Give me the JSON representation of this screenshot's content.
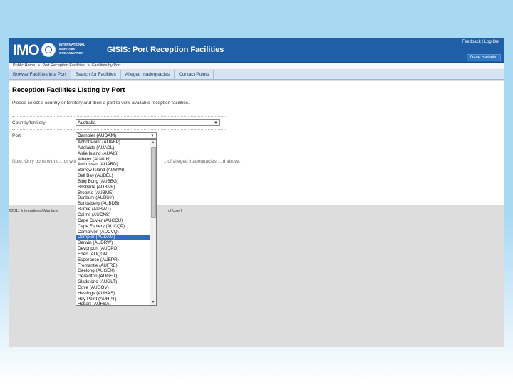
{
  "header": {
    "logo_text": "IMO",
    "org_lines": [
      "INTERNATIONAL",
      "MARITIME",
      "ORGANIZATION"
    ],
    "app_title": "GISIS: Port Reception Facilities",
    "feedback_link": "Feedback",
    "separator": "|",
    "logout_link": "Log Out",
    "user_button": "Dave Harbello"
  },
  "breadcrumb": [
    "Public Home",
    ">",
    "Port Reception Facilities",
    ">",
    "Facilities by Port"
  ],
  "tabs": [
    "Browse Facilities in a Port",
    "Search for Facilities",
    "Alleged Inadequacies",
    "Contact Points"
  ],
  "main": {
    "title": "Reception Facilities Listing by Port",
    "intro": "Please select a country or territory and then a port to view available reception facilities.",
    "country_label": "Country/territory:",
    "country_value": "Australia",
    "port_label": "Port:",
    "port_value": "Dampier (AUDAM)",
    "note_left": "Note: Only ports with c... or with specific informa...",
    "note_right": "...of alleged inadequacies, ...d above."
  },
  "footer": {
    "copyright": "©2011 International Maritime",
    "terms": "of Use ]"
  },
  "port_options": [
    "Abbot Point (AUABP)",
    "Adelaide (AUADL)",
    "Airlie Island (AUAIS)",
    "Albany (AUALH)",
    "Ardrossan (AUARD)",
    "Barrow Island (AUBWB)",
    "Bell Bay (AUBEL)",
    "Bing Bong (AUBBG)",
    "Brisbane (AUBNE)",
    "Broome (AUBME)",
    "Bunbury (AUBUY)",
    "Bundaberg (AUBDB)",
    "Burnie (AUBWT)",
    "Cairns (AUCNS)",
    "Cape Cuvier (AUCCU)",
    "Cape Flattery (AUCQP)",
    "Carnarvon (AUCVQ)",
    "Dampier (AUDAM)",
    "Darwin (AUDRW)",
    "Devonport (AUDPO)",
    "Eden (AUQDN)",
    "Esperance (AUEPR)",
    "Fremantle (AUFRE)",
    "Geelong (AUGEX)",
    "Geraldton (AUGET)",
    "Gladstone (AUGLT)",
    "Gove (AUGOV)",
    "Hastings (AUHAS)",
    "Hay Point (AUHPT)",
    "Hobart (AUHBA)"
  ],
  "selected_port_index": 17
}
